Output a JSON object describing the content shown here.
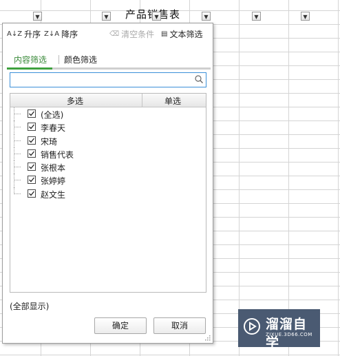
{
  "sheet": {
    "title": "产品销售表"
  },
  "filter_popup": {
    "toolbar": {
      "sort_asc": "升序",
      "sort_desc": "降序",
      "clear": "清空条件",
      "text_filter": "文本筛选"
    },
    "tabs": [
      {
        "label": "内容筛选",
        "active": true
      },
      {
        "label": "颜色筛选",
        "active": false
      }
    ],
    "search": {
      "value": "",
      "placeholder": ""
    },
    "list": {
      "columns": [
        "多选",
        "单选"
      ],
      "items": [
        {
          "label": "(全选)",
          "checked": true
        },
        {
          "label": "李春天",
          "checked": true
        },
        {
          "label": "宋琦",
          "checked": true
        },
        {
          "label": "销售代表",
          "checked": true
        },
        {
          "label": "张根本",
          "checked": true
        },
        {
          "label": "张婷婷",
          "checked": true
        },
        {
          "label": "赵文生",
          "checked": true
        }
      ]
    },
    "status": "(全部显示)",
    "buttons": {
      "ok": "确定",
      "cancel": "取消"
    }
  },
  "watermark": {
    "text": "溜溜自学",
    "sub": "ZIXUE.3D66.COM"
  },
  "colors": {
    "accent_green": "#3da13d",
    "search_border": "#3a8fd8",
    "watermark_bg": "#4a5a72"
  }
}
